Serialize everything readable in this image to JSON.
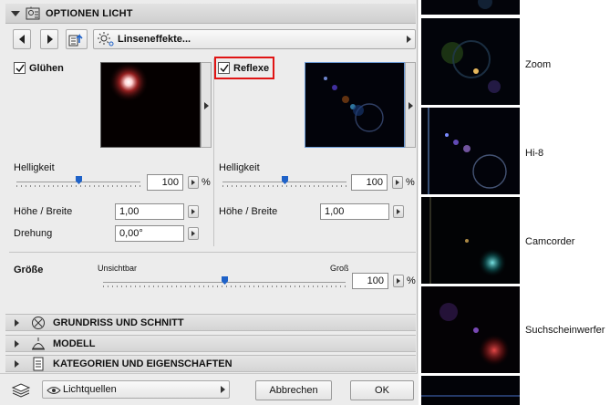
{
  "header": {
    "title": "OPTIONEN LICHT"
  },
  "toolbar": {
    "lens_effect_label": "Linseneffekte..."
  },
  "glow": {
    "label": "Glühen",
    "brightness_label": "Helligkeit",
    "brightness_value": "100",
    "brightness_unit": "%",
    "brightness_level": 0.5,
    "height_width_label": "Höhe / Breite",
    "height_width_value": "1,00",
    "rotation_label": "Drehung",
    "rotation_value": "0,00°"
  },
  "reflexe": {
    "label": "Reflexe",
    "brightness_label": "Helligkeit",
    "brightness_value": "100",
    "brightness_unit": "%",
    "brightness_level": 0.5,
    "height_width_label": "Höhe / Breite",
    "height_width_value": "1,00"
  },
  "size": {
    "label": "Größe",
    "min_label": "Unsichtbar",
    "max_label": "Groß",
    "value": "100",
    "unit": "%",
    "level": 0.5
  },
  "sections": [
    {
      "label": "GRUNDRISS UND SCHNITT",
      "icon": "circle-x-icon"
    },
    {
      "label": "MODELL",
      "icon": "lamp-icon"
    },
    {
      "label": "KATEGORIEN UND EIGENSCHAFTEN",
      "icon": "document-icon"
    }
  ],
  "footer": {
    "layer_popup": "Lichtquellen",
    "cancel_label": "Abbrechen",
    "ok_label": "OK"
  },
  "gallery": {
    "items": [
      {
        "label": "Zoom"
      },
      {
        "label": "Hi-8"
      },
      {
        "label": "Camcorder"
      },
      {
        "label": "Suchscheinwerfer"
      }
    ]
  },
  "colors": {
    "accent": "#1f62c8",
    "highlight": "#e01515"
  }
}
